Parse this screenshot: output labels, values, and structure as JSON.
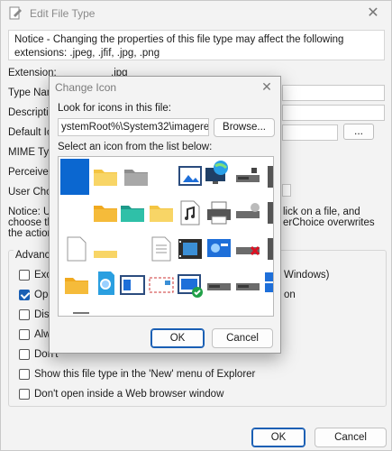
{
  "window": {
    "title": "Edit File Type",
    "notice": "Notice - Changing the properties of this file type may affect the following extensions: .jpeg, .jfif, .jpg, .png"
  },
  "fields": {
    "extension_label": "Extension:",
    "extension_value": ".jpg",
    "type_name_label": "Type Nam",
    "description_label": "Descriptio",
    "default_icon_label": "Default Ico",
    "mime_label": "MIME Type",
    "perceived_label": "Perceived T",
    "user_choice_label": "User Choic",
    "dots": "..."
  },
  "notice2": {
    "l1": "Notice: Use",
    "r1": "lick on a file, and",
    "l2": "choose the",
    "r2": "erChoice overwrites",
    "l3": "the actions"
  },
  "advanced": {
    "legend": "Advance",
    "items": [
      {
        "label": "Exclu",
        "checked": false
      },
      {
        "label": "Open",
        "checked": true
      },
      {
        "label": "Disab",
        "checked": false
      },
      {
        "label": "Alwa",
        "checked": false
      },
      {
        "label": "Don't",
        "checked": false
      },
      {
        "label": "Show this file type in the 'New' menu of Explorer",
        "checked": false
      },
      {
        "label": "Don't open inside a Web browser window",
        "checked": false
      }
    ],
    "right_frag_1": "Windows)",
    "right_frag_2": "on"
  },
  "buttons": {
    "ok": "OK",
    "cancel": "Cancel"
  },
  "dialog": {
    "title": "Change Icon",
    "look_label": "Look for icons in this file:",
    "path_value": "ystemRoot%\\System32\\imageres.dll",
    "browse": "Browse...",
    "select_label": "Select an icon from the list below:",
    "ok": "OK",
    "cancel": "Cancel"
  },
  "colors": {
    "accent": "#1a5fb4",
    "selection": "#0b67d0",
    "folder": "#f4c542"
  },
  "icons": [
    "edit-file-type-icon",
    "close-icon",
    "folder-icon",
    "picture-icon",
    "globe-monitor-icon",
    "drive-icon",
    "music-file-icon",
    "printer-icon",
    "document-icon",
    "video-icon",
    "network-drive-icon",
    "control-panel-icon",
    "check-badge-icon"
  ]
}
